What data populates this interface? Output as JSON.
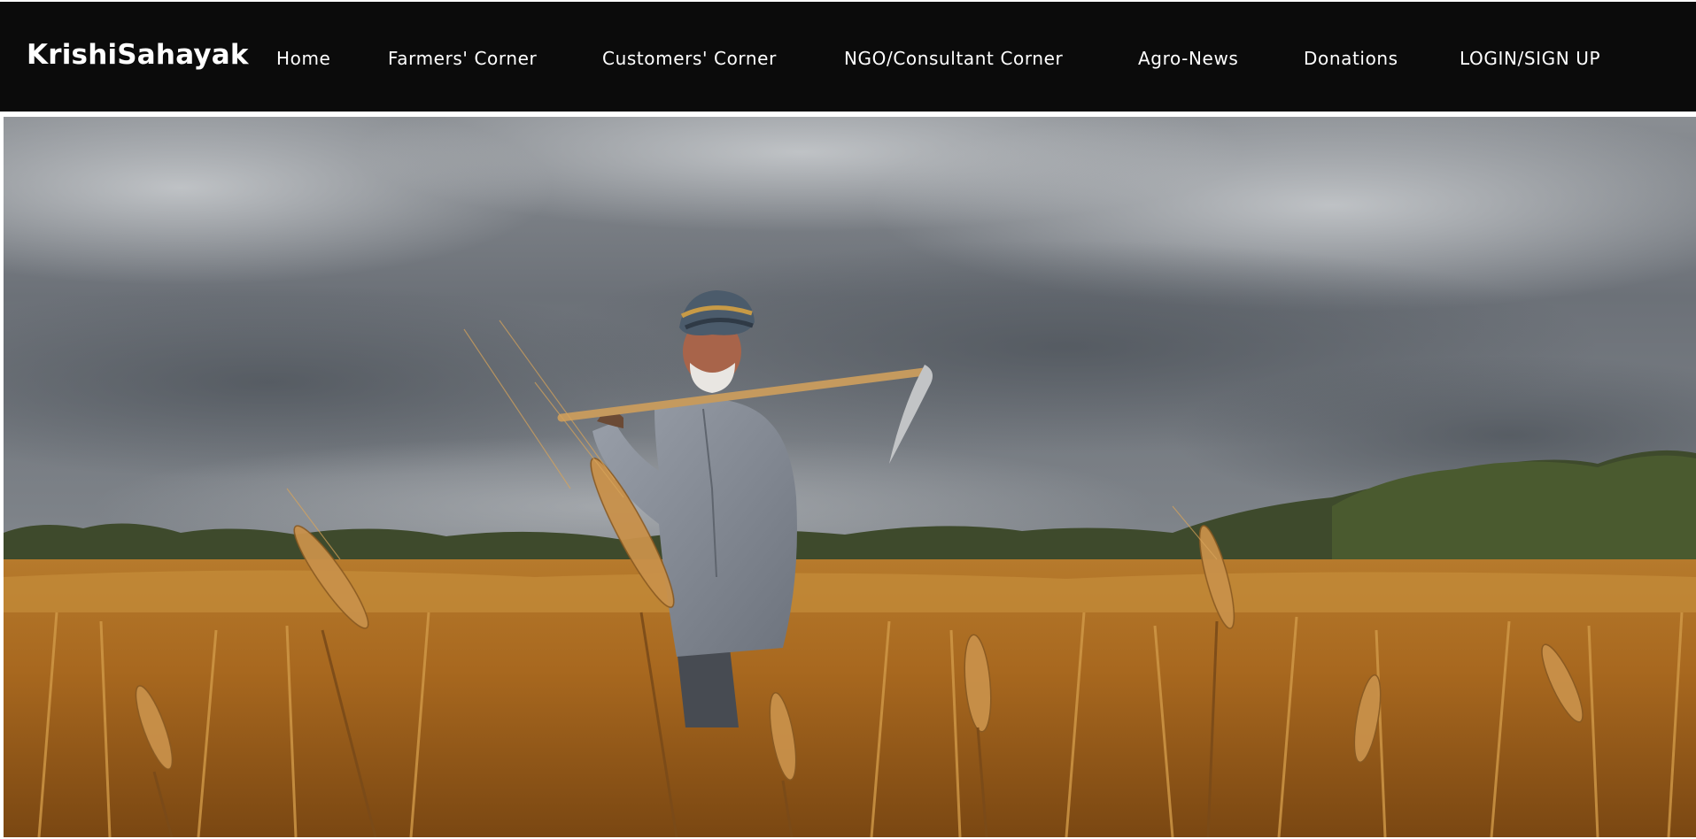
{
  "brand": {
    "name": "KrishiSahayak"
  },
  "nav": {
    "items": [
      {
        "label": "Home"
      },
      {
        "label": "Farmers' Corner"
      },
      {
        "label": "Customers' Corner"
      },
      {
        "label": "NGO/Consultant Corner"
      },
      {
        "label": "Agro-News"
      },
      {
        "label": "Donations"
      },
      {
        "label": "LOGIN/SIGN UP"
      }
    ]
  },
  "colors": {
    "navbar_bg": "#0b0b0b",
    "nav_text": "#ffffff"
  }
}
